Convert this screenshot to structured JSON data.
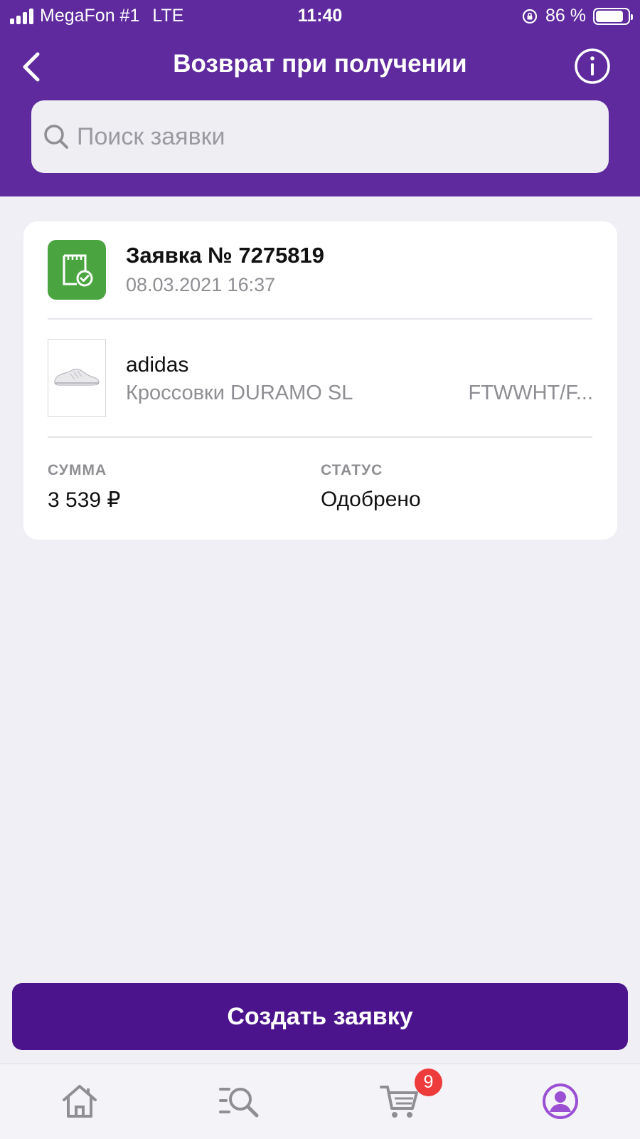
{
  "status_bar": {
    "carrier": "MegaFon #1",
    "network": "LTE",
    "time": "11:40",
    "battery": "86 %",
    "battery_level": 0.86
  },
  "nav": {
    "title": "Возврат при получении",
    "back_icon": "chevron-left-icon",
    "info_icon": "info-icon"
  },
  "search": {
    "placeholder": "Поиск заявки",
    "value": ""
  },
  "request": {
    "title": "Заявка № 7275819",
    "date": "08.03.2021 16:37",
    "brand": "adidas",
    "product": "Кроссовки DURAMO SL",
    "variant": "FTWWHT/F...",
    "sum_label": "СУММА",
    "sum_value": "3 539 ₽",
    "status_label": "СТАТУС",
    "status_value": "Одобрено"
  },
  "actions": {
    "create_label": "Создать заявку"
  },
  "tabbar": {
    "cart_badge": "9",
    "items": [
      "home-icon",
      "catalog-search-icon",
      "cart-icon",
      "profile-icon"
    ]
  },
  "colors": {
    "header": "#5e2a9d",
    "primary_button": "#4b148c",
    "approved_icon": "#4aa541",
    "badge": "#ee3b3b",
    "active_tab": "#9b4fd3"
  }
}
